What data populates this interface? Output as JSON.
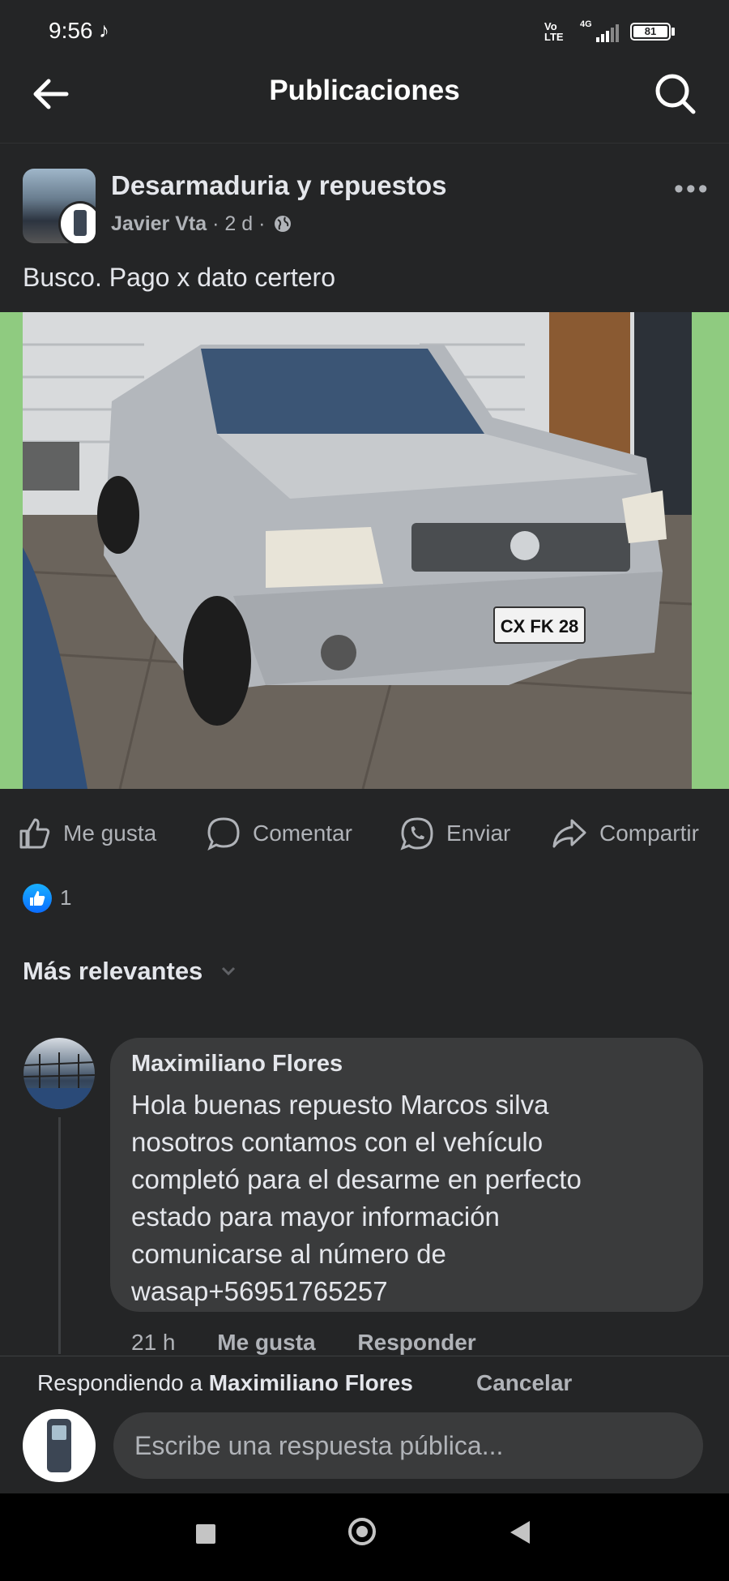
{
  "status_bar": {
    "time": "9:56",
    "network_top": "Vo",
    "network_bottom": "LTE",
    "network_type": "4G",
    "battery": "81"
  },
  "header": {
    "title": "Publicaciones"
  },
  "post": {
    "group_name": "Desarmaduria y repuestos",
    "author": "Javier Vta",
    "time": "2 d",
    "separator": "·",
    "text": "Busco. Pago x dato certero",
    "plate": "CX FK 28"
  },
  "actions": {
    "like": "Me gusta",
    "comment": "Comentar",
    "send": "Enviar",
    "share": "Compartir"
  },
  "reactions": {
    "count": "1"
  },
  "comments_sort": "Más relevantes",
  "comment": {
    "author": "Maximiliano Flores",
    "text": "Hola buenas repuesto Marcos silva\nnosotros contamos con el vehículo\ncompletó para el desarme en perfecto\nestado para mayor información\ncomunicarse al número de\nwasap+56951765257",
    "time": "21 h",
    "like": "Me gusta",
    "reply": "Responder"
  },
  "reply_bar": {
    "replying_prefix": "Respondiendo a",
    "replying_to": "Maximiliano Flores",
    "cancel": "Cancelar",
    "placeholder": "Escribe una respuesta pública..."
  },
  "colors": {
    "background": "#242526",
    "bubble": "#3a3b3c",
    "text_primary": "#e4e6eb",
    "text_secondary": "#b0b3b8",
    "like_blue": "#0a6cff"
  }
}
